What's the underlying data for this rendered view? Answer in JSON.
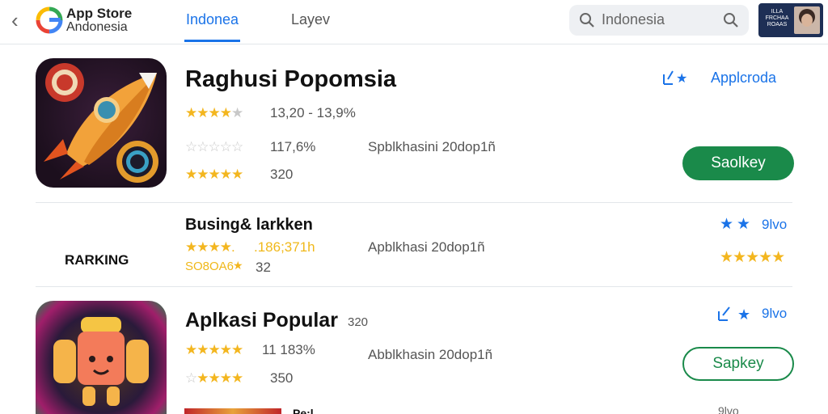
{
  "header": {
    "back_glyph": "‹",
    "brand_line1": "App Store",
    "brand_line2": "Andonesia",
    "tabs": [
      {
        "label": "Indonea",
        "active": true
      },
      {
        "label": "Layev",
        "active": false
      }
    ],
    "search": {
      "value": "Indonesia"
    },
    "avatar_text": "ILLA FRCHAA ROAAS"
  },
  "apps": [
    {
      "title": "Raghusi Popomsia",
      "rating_line1": "13,20 - 13,9%",
      "rating_line2": "117,6%",
      "rating_line3": "320",
      "subtitle": "Spblkhasini 20dop1ñ",
      "side_label": "Applcroda",
      "button": "Saolkey"
    },
    {
      "title": "Busing& larkken",
      "rating_line1": ".186;371h",
      "rating_line2": "SO8OA6",
      "rating_line3": "32",
      "subtitle": "Apblkhasi 20dop1ñ",
      "side_label": "9lvo",
      "ranking_label": "RARKING"
    },
    {
      "title": "Aplkasi Popular",
      "title_suffix": "320",
      "rating_line1": "11 183%",
      "rating_line2": "350",
      "subtitle": "Abblkhasin 20dop1ñ",
      "side_label": "9lvo",
      "button": "Sapkey"
    }
  ],
  "peek_row": {
    "title": "Pe:l",
    "meta": "9lvo"
  },
  "colors": {
    "accent_blue": "#1a73e8",
    "install_green": "#1a8a4a",
    "star_yellow": "#f3b61f"
  }
}
